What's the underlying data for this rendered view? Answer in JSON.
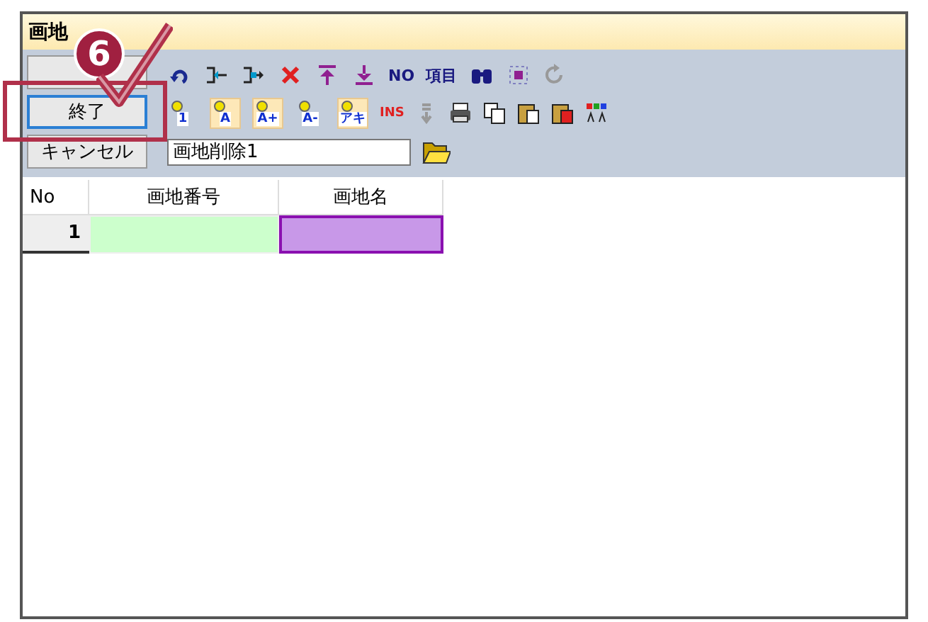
{
  "window": {
    "title": "画地"
  },
  "side_buttons": [
    {
      "label": "終了",
      "focused": true
    },
    {
      "label": "キャンセル",
      "focused": false
    }
  ],
  "toolbar_row1": [
    {
      "kind": "undo"
    },
    {
      "kind": "insert-left"
    },
    {
      "kind": "insert-right"
    },
    {
      "kind": "delete"
    },
    {
      "kind": "top"
    },
    {
      "kind": "bottom"
    },
    {
      "kind": "text",
      "label": "NO"
    },
    {
      "kind": "text",
      "label": "項目"
    },
    {
      "kind": "binoculars"
    },
    {
      "kind": "select"
    },
    {
      "kind": "redo"
    }
  ],
  "toolbar_row2": [
    {
      "kind": "pin",
      "label": "1",
      "selected": false
    },
    {
      "kind": "pin",
      "label": "A",
      "selected": true
    },
    {
      "kind": "pin",
      "label": "A+",
      "selected": true
    },
    {
      "kind": "pin",
      "label": "A-",
      "selected": false
    },
    {
      "kind": "pin",
      "label": "アキ",
      "selected": true
    },
    {
      "kind": "ins",
      "label": "INS"
    },
    {
      "kind": "down"
    },
    {
      "kind": "print"
    },
    {
      "kind": "copy"
    },
    {
      "kind": "paste"
    },
    {
      "kind": "paste-red"
    },
    {
      "kind": "colors"
    }
  ],
  "name_field": {
    "value": "画地削除1"
  },
  "table": {
    "columns": [
      "No",
      "画地番号",
      "画地名"
    ],
    "rows": [
      {
        "no": "1",
        "cells": [
          {
            "color": "#ccffcc",
            "selected": false
          },
          {
            "color": "#c898e8",
            "selected": true
          }
        ]
      }
    ]
  },
  "annotation": {
    "step": "6"
  }
}
